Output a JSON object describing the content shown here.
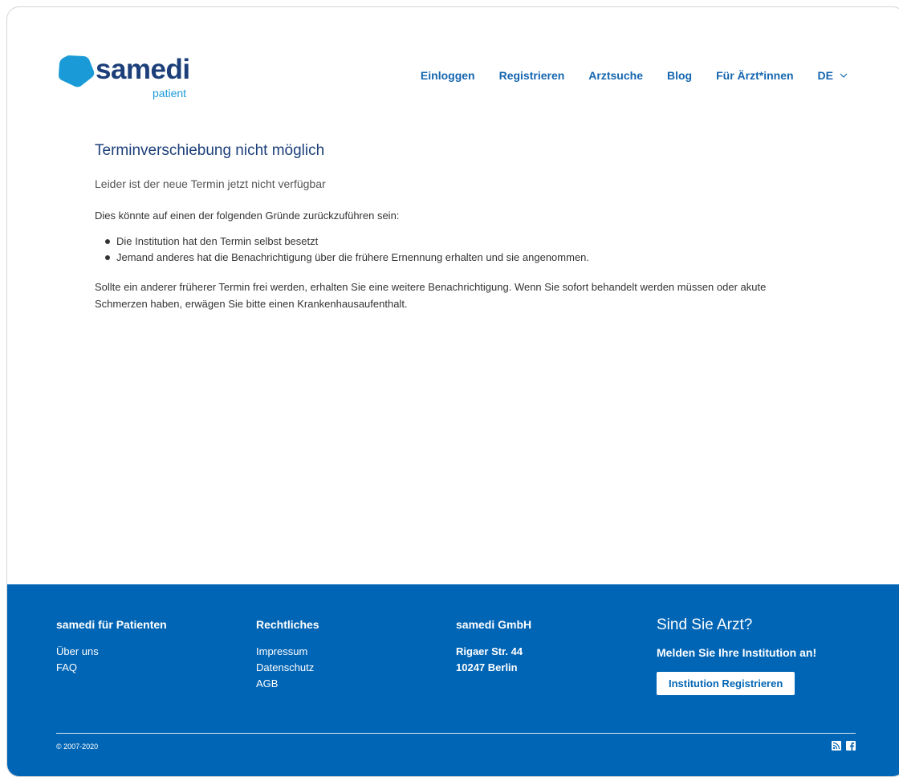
{
  "logo": {
    "wordmark": "samedi",
    "sub": "patient"
  },
  "nav": {
    "items": [
      "Einloggen",
      "Registrieren",
      "Arztsuche",
      "Blog",
      "Für Ärzt*innen"
    ],
    "language": "DE"
  },
  "main": {
    "title": "Terminverschiebung nicht möglich",
    "subtitle": "Leider ist der neue Termin jetzt nicht verfügbar",
    "reasons_intro": "Dies könnte auf einen der folgenden Gründe zurückzuführen sein:",
    "reasons": [
      "Die Institution hat den Termin selbst besetzt",
      "Jemand anderes hat die Benachrichtigung über die frühere Ernennung erhalten und sie angenommen."
    ],
    "note": "Sollte ein anderer früherer Termin frei werden, erhalten Sie eine weitere Benachrichtigung. Wenn Sie sofort behandelt werden müssen oder akute Schmerzen haben, erwägen Sie bitte einen Krankenhausaufenthalt."
  },
  "footer": {
    "col1": {
      "heading": "samedi für Patienten",
      "links": [
        "Über uns",
        "FAQ"
      ]
    },
    "col2": {
      "heading": "Rechtliches",
      "links": [
        "Impressum",
        "Datenschutz",
        "AGB"
      ]
    },
    "col3": {
      "heading": "samedi GmbH",
      "address": [
        "Rigaer Str. 44",
        "10247 Berlin"
      ]
    },
    "cta": {
      "title": "Sind Sie Arzt?",
      "subtitle": "Melden Sie Ihre Institution an!",
      "button": "Institution Registrieren"
    },
    "copyright": "© 2007-2020",
    "social_icons": [
      "rss-icon",
      "facebook-icon"
    ]
  },
  "colors": {
    "brand_dark": "#1c3f7a",
    "brand_light": "#1a9bd8",
    "nav_link": "#1566b0",
    "footer_bg": "#0165b5"
  }
}
